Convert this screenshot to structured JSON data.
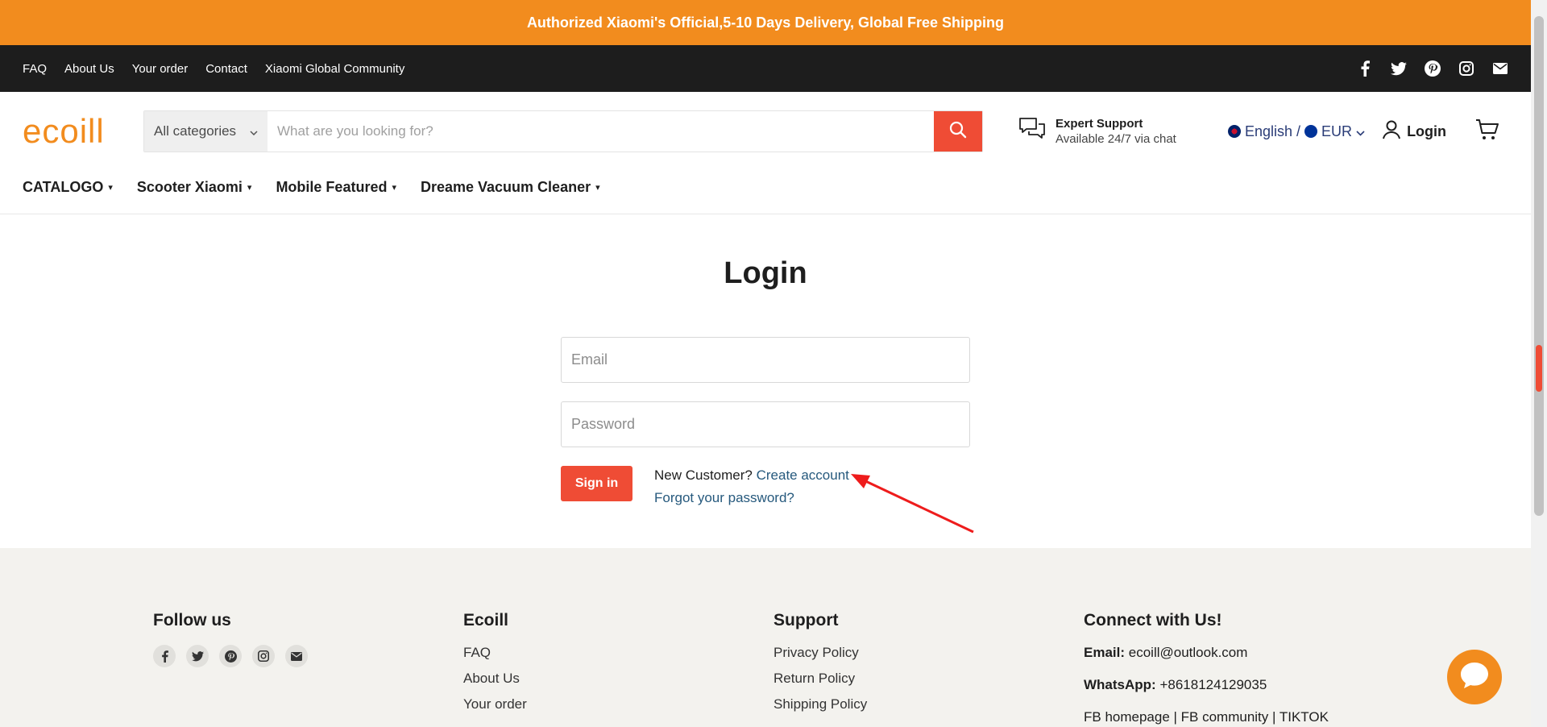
{
  "announcement": "Authorized Xiaomi's Official,5-10 Days Delivery, Global Free Shipping",
  "utility_links": [
    "FAQ",
    "About Us",
    "Your order",
    "Contact",
    "Xiaomi Global Community"
  ],
  "social_icons": [
    "facebook-icon",
    "twitter-icon",
    "pinterest-icon",
    "instagram-icon",
    "mail-icon"
  ],
  "logo": "ecoill",
  "search": {
    "category": "All categories",
    "placeholder": "What are you looking for?"
  },
  "support": {
    "title": "Expert Support",
    "subtitle": "Available 24/7 via chat"
  },
  "locale": {
    "language": "English /",
    "currency": "EUR"
  },
  "login_label": "Login",
  "nav": [
    "CATALOGO",
    "Scooter Xiaomi",
    "Mobile Featured",
    "Dreame Vacuum Cleaner"
  ],
  "login": {
    "title": "Login",
    "email_placeholder": "Email",
    "password_placeholder": "Password",
    "signin_label": "Sign in",
    "new_customer": "New Customer?",
    "create_account": "Create account",
    "forgot_password": "Forgot your password?"
  },
  "footer": {
    "follow_title": "Follow us",
    "ecoill_title": "Ecoill",
    "ecoill_links": [
      "FAQ",
      "About Us",
      "Your order"
    ],
    "support_title": "Support",
    "support_links": [
      "Privacy Policy",
      "Return Policy",
      "Shipping Policy"
    ],
    "connect_title": "Connect with Us!",
    "email_label": "Email:",
    "email_value": "ecoill@outlook.com",
    "whatsapp_label": "WhatsApp:",
    "whatsapp_value": "+8618124129035",
    "social_line": "FB homepage | FB community | TIKTOK"
  },
  "colors": {
    "brand_orange": "#f28c1e",
    "accent_red": "#ef4c35",
    "dark_bar": "#1d1d1d",
    "link_blue": "#26597d"
  }
}
